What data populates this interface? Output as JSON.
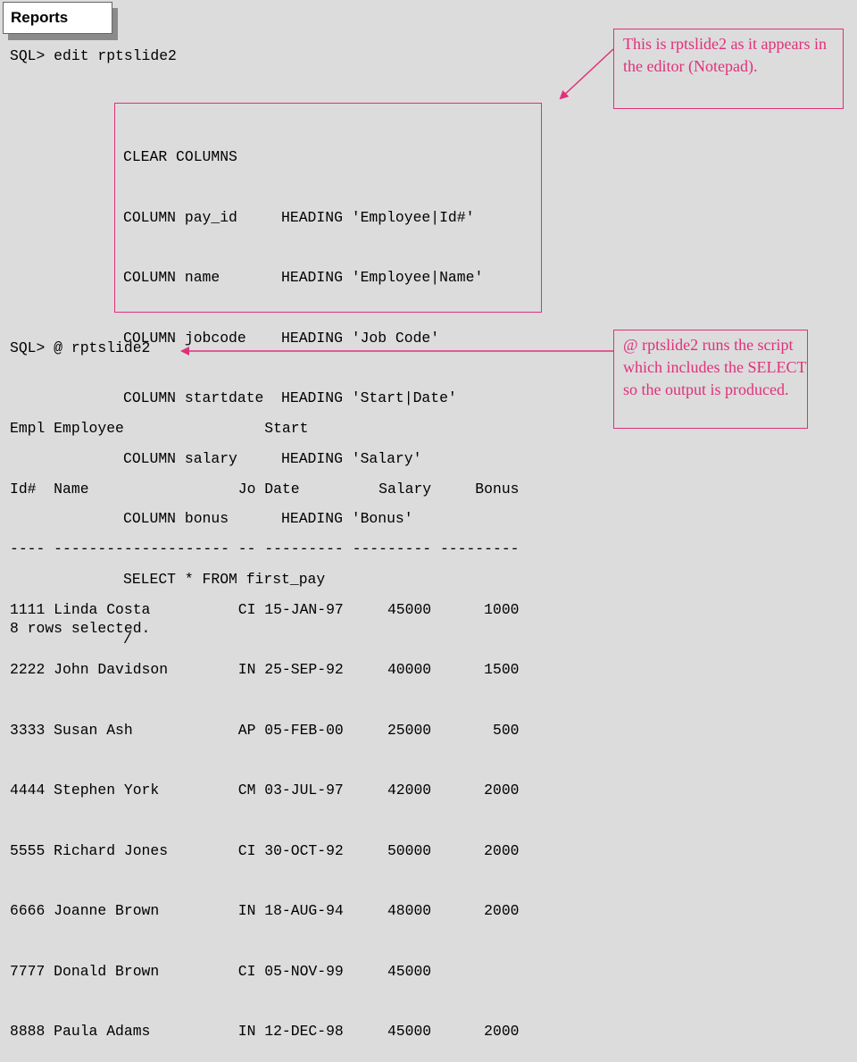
{
  "title": "Reports",
  "prompt1": "SQL> edit rptslide2",
  "editor_lines": [
    "CLEAR COLUMNS",
    "COLUMN pay_id     HEADING 'Employee|Id#'",
    "COLUMN name       HEADING 'Employee|Name'",
    "COLUMN jobcode    HEADING 'Job Code'",
    "COLUMN startdate  HEADING 'Start|Date'",
    "COLUMN salary     HEADING 'Salary'",
    "COLUMN bonus      HEADING 'Bonus'",
    "SELECT * FROM first_pay",
    "/"
  ],
  "note1": "This is rptslide2 as it appears in the editor (Notepad).",
  "prompt2": "SQL> @ rptslide2",
  "note2": "@ rptslide2 runs the script which includes the SELECT so the output is produced.",
  "output_lines": [
    "Empl Employee                Start",
    "Id#  Name                 Jo Date         Salary     Bonus",
    "---- -------------------- -- --------- --------- ---------",
    "1111 Linda Costa          CI 15-JAN-97     45000      1000",
    "2222 John Davidson        IN 25-SEP-92     40000      1500",
    "3333 Susan Ash            AP 05-FEB-00     25000       500",
    "4444 Stephen York         CM 03-JUL-97     42000      2000",
    "5555 Richard Jones        CI 30-OCT-92     50000      2000",
    "6666 Joanne Brown         IN 18-AUG-94     48000      2000",
    "7777 Donald Brown         CI 05-NOV-99     45000",
    "8888 Paula Adams          IN 12-DEC-98     45000      2000"
  ],
  "footer": "8 rows selected.",
  "colors": {
    "accent": "#e0307a",
    "background": "#dcdcdc"
  }
}
